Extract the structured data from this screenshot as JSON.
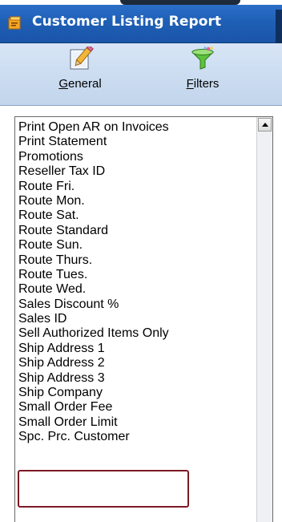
{
  "window": {
    "title": "Customer Listing Report"
  },
  "toolbar": {
    "buttons": [
      {
        "label_accel": "G",
        "label_rest": "eneral",
        "icon": "pencil-edit-icon"
      },
      {
        "label_accel": "F",
        "label_rest": "ilters",
        "icon": "funnel-filter-icon"
      }
    ]
  },
  "field_list": {
    "items": [
      "Print Open AR on Invoices",
      "Print Statement",
      "Promotions",
      "Reseller Tax ID",
      "Route Fri.",
      "Route Mon.",
      "Route Sat.",
      "Route Standard",
      "Route Sun.",
      "Route Thurs.",
      "Route Tues.",
      "Route Wed.",
      "Sales Discount %",
      "Sales ID",
      "Sell Authorized Items Only",
      "Ship Address 1",
      "Ship Address 2",
      "Ship Address 3",
      "Ship Company",
      "Small Order Fee",
      "Small Order Limit",
      "Spc. Prc. Customer"
    ],
    "highlighted_items": [
      "Small Order Fee",
      "Small Order Limit"
    ],
    "highlight_color": "#7d1a24"
  },
  "colors": {
    "titlebar": "#1f5fb6",
    "toolbar": "#c9daf0"
  }
}
